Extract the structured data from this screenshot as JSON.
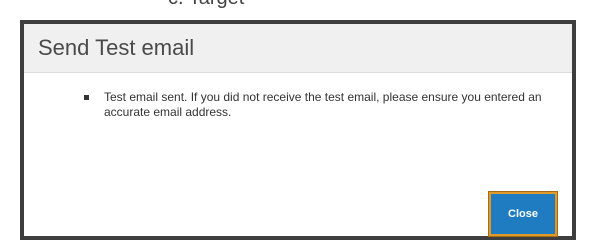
{
  "background_heading": "c. Target",
  "dialog": {
    "title": "Send Test email",
    "message": "Test email sent. If you did not receive the test email, please ensure you entered an accurate email address.",
    "close_label": "Close"
  },
  "colors": {
    "button_bg": "#1f7cc1",
    "button_border": "#e09a2a",
    "dialog_border": "#3e3e3e",
    "header_bg": "#f0f0f0"
  }
}
